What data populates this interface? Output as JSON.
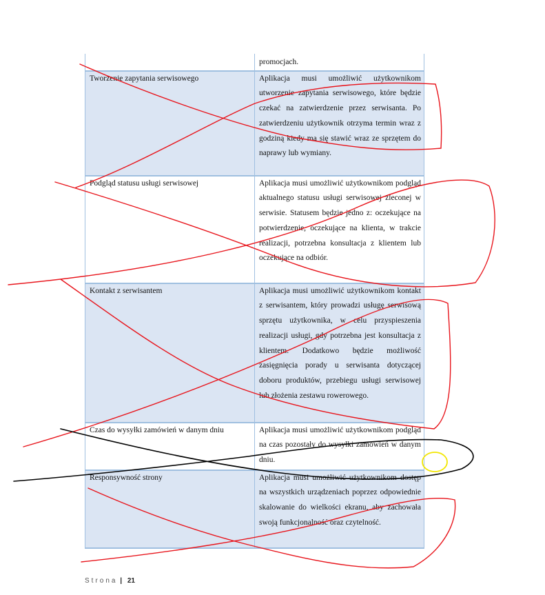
{
  "table": {
    "rows": [
      {
        "name": "",
        "desc": "promocjach.",
        "shade": "plain"
      },
      {
        "name": "Tworzenie zapytania serwisowego",
        "desc": "Aplikacja musi umożliwić użytkownikom utworzenie zapytania serwisowego, które będzie czekać na zatwierdzenie przez serwisanta. Po zatwierdzeniu użytkownik otrzyma termin wraz z godziną kiedy ma się stawić wraz ze sprzętem do naprawy lub wymiany.",
        "shade": "shaded"
      },
      {
        "name": "Podgląd statusu usługi serwisowej",
        "desc": "Aplikacja musi umożliwić użytkownikom podgląd aktualnego statusu usługi serwisowej zleconej w serwisie. Statusem będzie jedno z: oczekujące na potwierdzenie, oczekujące na klienta, w trakcie realizacji, potrzebna konsultacja z klientem lub oczekujące na odbiór.",
        "shade": "plain"
      },
      {
        "name": "Kontakt z serwisantem",
        "desc": "Aplikacja musi umożliwić użytkownikom kontakt z serwisantem, który prowadzi usługę serwisową sprzętu użytkownika, w celu przyspieszenia realizacji usługi, gdy potrzebna jest konsultacja z klientem. Dodatkowo będzie możliwość zasięgnięcia porady u serwisanta dotyczącej doboru produktów, przebiegu usługi serwisowej lub złożenia zestawu rowerowego.",
        "shade": "shaded"
      },
      {
        "name": "Czas do wysyłki zamówień w danym dniu",
        "desc": "Aplikacja musi umożliwić użytkownikom podgląd na czas pozostały do wysyłki zamówień w danym dniu.",
        "shade": "plain"
      },
      {
        "name": "Responsywność strony",
        "desc": "Aplikacja musi umożliwić użytkownikom dostęp na wszystkich urządzeniach poprzez odpowiednie skalowanie do wielkości ekranu, aby zachowała swoją funkcjonalność oraz czytelność.",
        "shade": "shaded"
      }
    ]
  },
  "footer": {
    "label": "Strona",
    "separator": "|",
    "page": "21"
  },
  "annotations": {
    "red_color": "#e8141b",
    "black_color": "#000000",
    "yellow_color": "#f2e600"
  }
}
